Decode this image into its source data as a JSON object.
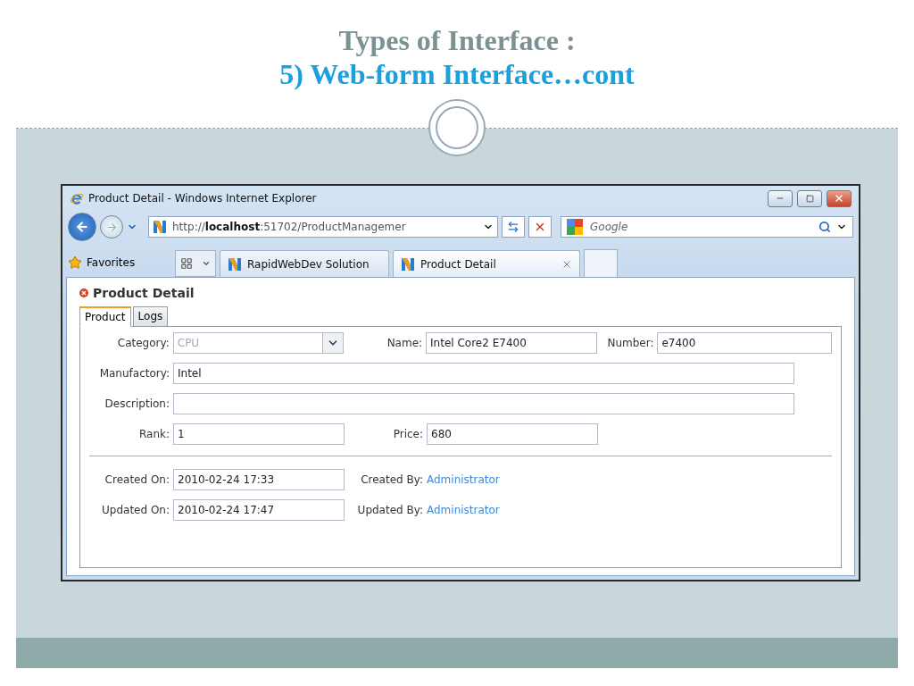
{
  "slide": {
    "title_line_1": "Types of Interface :",
    "title_line_2": "5) Web-form Interface…cont"
  },
  "browser": {
    "title": "Product Detail - Windows Internet Explorer",
    "address": "http://**localhost**:51702/ProductManagemer",
    "search": {
      "placeholder": "Google"
    },
    "favorites": "Favorites",
    "tabs": [
      {
        "label": "RapidWebDev Solution",
        "selected": false
      },
      {
        "label": "Product Detail",
        "selected": true
      }
    ]
  },
  "page": {
    "heading": "Product Detail",
    "tabs": [
      {
        "label": "Product",
        "selected": true
      },
      {
        "label": "Logs",
        "selected": false
      }
    ],
    "rows": [
      {
        "fields": [
          {
            "label": "Category:",
            "kind": "select",
            "value": "CPU",
            "disabled": true
          },
          {
            "label": "Name:",
            "kind": "text",
            "value": "Intel Core2 E7400"
          },
          {
            "label": "Number:",
            "kind": "text",
            "value": "e7400"
          }
        ]
      },
      {
        "fields": [
          {
            "label": "Manufactory:",
            "kind": "wide",
            "value": "Intel"
          }
        ]
      },
      {
        "fields": [
          {
            "label": "Description:",
            "kind": "wide"
          }
        ]
      },
      {
        "fields": [
          {
            "label": "Rank:",
            "kind": "text",
            "value": "1"
          },
          {
            "label": "Price:",
            "kind": "text",
            "value": "680"
          }
        ]
      },
      {
        "fields": [
          {
            "label": "Created On:",
            "kind": "text",
            "value": "2010-02-24 17:33"
          },
          {
            "label": "Created By:",
            "kind": "link",
            "value": "Administrator"
          }
        ],
        "divider_before": true
      },
      {
        "fields": [
          {
            "label": "Updated On:",
            "kind": "text",
            "value": "2010-02-24 17:47"
          },
          {
            "label": "Updated By:",
            "kind": "link",
            "value": "Administrator"
          }
        ]
      }
    ]
  }
}
